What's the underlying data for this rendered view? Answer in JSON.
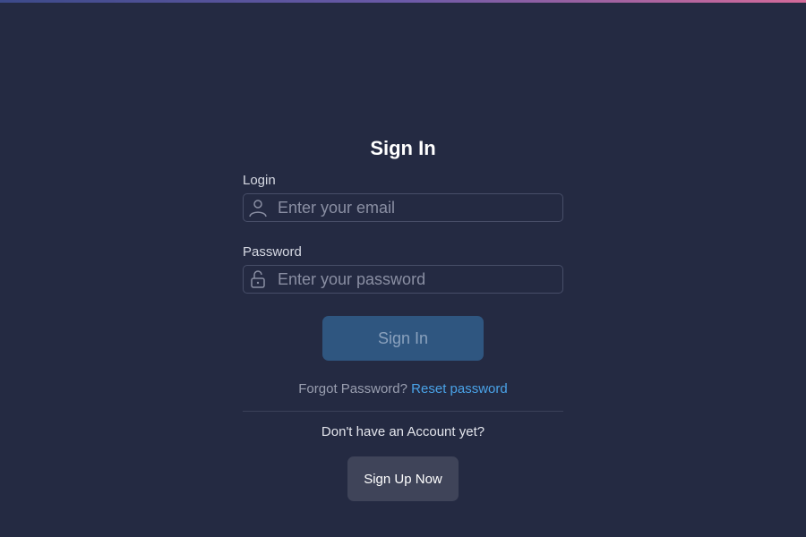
{
  "form": {
    "title": "Sign In",
    "login_label": "Login",
    "login_placeholder": "Enter your email",
    "login_value": "",
    "password_label": "Password",
    "password_placeholder": "Enter your password",
    "password_value": "",
    "signin_button": "Sign In",
    "forgot_text": "Forgot Password?",
    "reset_link": "Reset password",
    "no_account_text": "Don't have an Account yet?",
    "signup_button": "Sign Up Now"
  },
  "icons": {
    "login": "user-icon",
    "password": "lock-icon"
  },
  "colors": {
    "background": "#242a42",
    "accent_link": "#4aa3e8",
    "signin_button_bg": "#2f5680",
    "signup_button_bg": "#3f4459"
  }
}
